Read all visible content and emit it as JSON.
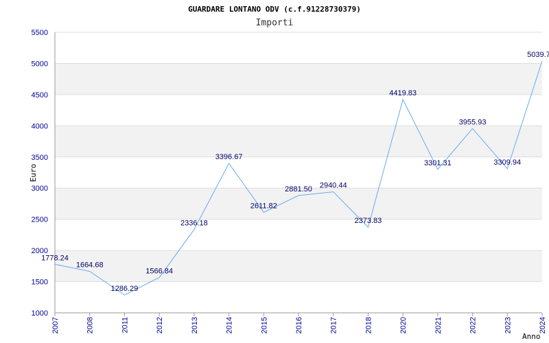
{
  "chart_data": {
    "type": "line",
    "title": "GUARDARE LONTANO ODV (c.f.91228730379)",
    "subtitle": "Importi",
    "xlabel": "Anno",
    "ylabel": "Euro",
    "ylim": [
      1000,
      5500
    ],
    "yticks": [
      "1000",
      "1500",
      "2000",
      "2500",
      "3000",
      "3500",
      "4000",
      "4500",
      "5000",
      "5500"
    ],
    "categories": [
      "2007",
      "2008",
      "2011",
      "2012",
      "2013",
      "2014",
      "2015",
      "2016",
      "2017",
      "2018",
      "2020",
      "2021",
      "2022",
      "2023",
      "2024"
    ],
    "values": [
      1778.24,
      1664.68,
      1286.29,
      1566.84,
      2336.18,
      3396.67,
      2611.82,
      2881.5,
      2940.44,
      2373.83,
      4419.83,
      3301.31,
      3955.93,
      3309.94,
      5039.7
    ],
    "value_labels": [
      "1778.24",
      "1664.68",
      "1286.29",
      "1566.84",
      "2336.18",
      "3396.67",
      "2611.82",
      "2881.50",
      "2940.44",
      "2373.83",
      "4419.83",
      "3301.31",
      "3955.93",
      "3309.94",
      "5039.7"
    ],
    "grid": true,
    "banded_background": true,
    "colors": {
      "line": "#66aaee",
      "band": "#f2f2f2",
      "grid": "#dddddd",
      "axis": "#999999",
      "tick_text": "#000099",
      "label_text": "#000066"
    }
  }
}
